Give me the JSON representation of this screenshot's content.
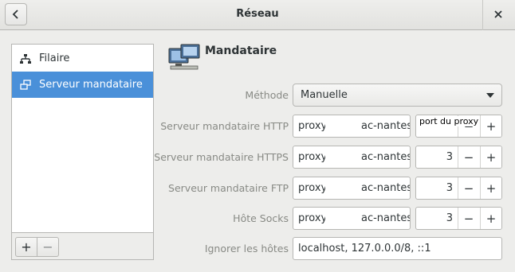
{
  "window": {
    "title": "Réseau"
  },
  "titlebar": {
    "back_icon": "chevron-left-icon",
    "close_label": "✕"
  },
  "sidebar": {
    "items": [
      {
        "label": "Filaire",
        "icon": "wired-network-icon"
      },
      {
        "label": "Serveur mandataire",
        "icon": "proxy-icon"
      }
    ],
    "selected": "Serveur mandataire",
    "add_label": "+",
    "remove_label": "−"
  },
  "panel": {
    "title": "Mandataire",
    "method": {
      "label": "Méthode",
      "value": "Manuelle"
    },
    "rows": [
      {
        "label": "Serveur mandataire HTTP",
        "host_start": "proxy",
        "host_end": "ac-nantes",
        "port": ""
      },
      {
        "label": "Serveur mandataire HTTPS",
        "host_start": "proxy",
        "host_end": "ac-nantes",
        "port": "3"
      },
      {
        "label": "Serveur mandataire FTP",
        "host_start": "proxy",
        "host_end": "ac-nantes",
        "port": "3"
      },
      {
        "label": "Hôte Socks",
        "host_start": "proxy",
        "host_end": "ac-nantes",
        "port": "3"
      }
    ],
    "tooltip": "port du proxy",
    "ignore": {
      "label": "Ignorer les hôtes",
      "value": "localhost, 127.0.0.0/8, ::1"
    },
    "minus_label": "−",
    "plus_label": "+"
  },
  "colors": {
    "accent": "#4a90d9",
    "label": "#888a85"
  }
}
